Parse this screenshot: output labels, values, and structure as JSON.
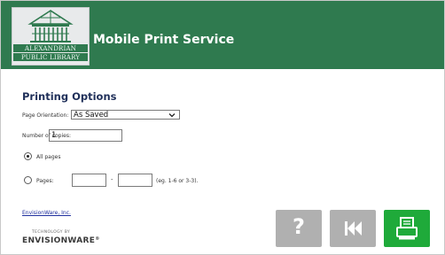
{
  "header": {
    "logo_line1": "ALEXANDRIAN",
    "logo_line2": "PUBLIC LIBRARY",
    "app_title": "Mobile Print Service"
  },
  "options": {
    "section_title": "Printing Options",
    "orientation_label": "Page Orientation:",
    "orientation_value": "As Saved",
    "copies_label": "Number of copies:",
    "copies_value": "1",
    "all_pages_label": "All pages",
    "pages_label": "Pages:",
    "range_dash": "-",
    "range_hint": "(eg. 1-6 or 3-3).",
    "all_pages_selected": true
  },
  "footer": {
    "link_text": "EnvisionWare, Inc.",
    "tech_by": "TECHNOLOGY BY",
    "brand": "ENVISIONWARE"
  },
  "buttons": {
    "help_label": "?",
    "help_color": "#b0b0b0",
    "back_color": "#b0b0b0",
    "print_color": "#1faa3a"
  },
  "colors": {
    "header_bg": "#2f7a4f",
    "title_color": "#1f2f59"
  }
}
